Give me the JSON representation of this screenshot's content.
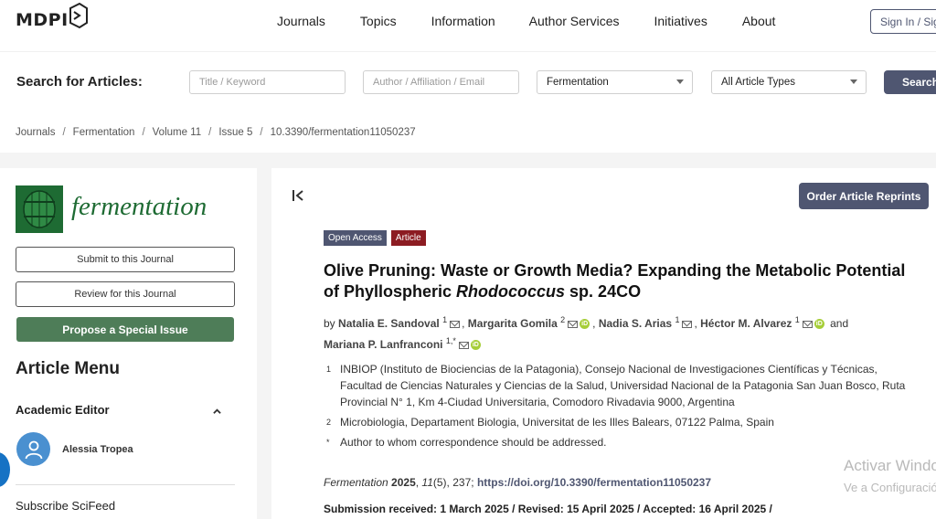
{
  "topnav": {
    "logo_text": "MDPI",
    "links": [
      "Journals",
      "Topics",
      "Information",
      "Author Services",
      "Initiatives",
      "About"
    ],
    "signin_label": "Sign In / Sig"
  },
  "search": {
    "label": "Search for Articles:",
    "title_placeholder": "Title / Keyword",
    "author_placeholder": "Author / Affiliation / Email",
    "journal_selected": "Fermentation",
    "type_selected": "All Article Types",
    "button_label": "Search"
  },
  "breadcrumb": [
    "Journals",
    "Fermentation",
    "Volume 11",
    "Issue 5",
    "10.3390/fermentation11050237"
  ],
  "sidebar": {
    "journal_name": "fermentation",
    "submit_label": "Submit to this Journal",
    "review_label": "Review for this Journal",
    "special_issue_label": "Propose a Special Issue",
    "article_menu": "Article Menu",
    "academic_editor_heading": "Academic Editor",
    "editor_name": "Alessia Tropea",
    "subscribe_label": "Subscribe SciFeed"
  },
  "article": {
    "reprints_label": "Order Article Reprints",
    "badge_open_access": "Open Access",
    "badge_article": "Article",
    "title_part1": "Olive Pruning: Waste or Growth Media? Expanding the Metabolic Potential of Phyllospheric ",
    "title_italic": "Rhodococcus",
    "title_part2": " sp. 24CO",
    "by": "by",
    "authors": [
      {
        "name": "Natalia E. Sandoval",
        "sup": "1"
      },
      {
        "name": "Margarita Gomila",
        "sup": "2"
      },
      {
        "name": "Nadia S. Arias",
        "sup": "1"
      },
      {
        "name": "Héctor M. Alvarez",
        "sup": "1"
      },
      {
        "name": "Mariana P. Lanfranconi",
        "sup": "1,*"
      }
    ],
    "and": "and",
    "affiliations": [
      {
        "num": "1",
        "text": "INBIOP (Instituto de Biociencias de la Patagonia), Consejo Nacional de Investigaciones Científicas y Técnicas, Facultad de Ciencias Naturales y Ciencias de la Salud, Universidad Nacional de la Patagonia San Juan Bosco, Ruta Provincial N° 1, Km 4-Ciudad Universitaria, Comodoro Rivadavia 9000, Argentina"
      },
      {
        "num": "2",
        "text": "Microbiologia, Departament Biologia, Universitat de les Illes Balears, 07122 Palma, Spain"
      },
      {
        "num": "*",
        "text": "Author to whom correspondence should be addressed."
      }
    ],
    "citation_journal": "Fermentation",
    "citation_year": "2025",
    "citation_vol": "11",
    "citation_rest": "(5), 237;",
    "citation_doi": "https://doi.org/10.3390/fermentation11050237",
    "dates": "Submission received: 1 March 2025 / Revised: 15 April 2025 / Accepted: 16 April 2025 /"
  },
  "watermark": {
    "line1": "Activar Windows",
    "line2": "Ve a Configuración"
  },
  "colors": {
    "accent": "#4f5671",
    "journal_green": "#1e6b33",
    "special_issue_green": "#4e7d58",
    "article_badge": "#8c1c22",
    "orcid": "#a6ce39"
  }
}
